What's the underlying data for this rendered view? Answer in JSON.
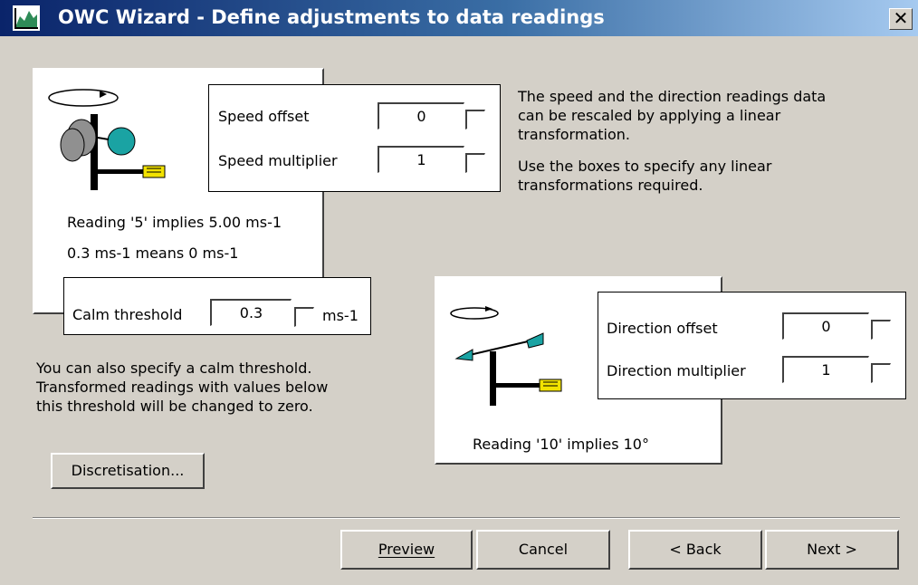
{
  "window": {
    "title": "OWC Wizard - Define adjustments to data readings",
    "close_glyph": "✕"
  },
  "speed": {
    "offset_label": "Speed offset",
    "offset_value": "0",
    "multiplier_label": "Speed multiplier",
    "multiplier_value": "1",
    "reading_text": "Reading '5' implies 5.00 ms-1",
    "threshold_text": "0.3 ms-1 means 0 ms-1"
  },
  "calm": {
    "label": "Calm threshold",
    "value": "0.3",
    "unit": "ms-1",
    "help_lines": [
      "You can also specify a calm threshold.",
      "Transformed readings with values below",
      "this threshold will be changed to zero."
    ]
  },
  "info": {
    "lines1": [
      "The speed and the direction readings data",
      "can be rescaled by applying a linear",
      "transformation."
    ],
    "lines2": [
      "Use the boxes to specify any linear",
      "transformations required."
    ]
  },
  "direction": {
    "offset_label": "Direction offset",
    "offset_value": "0",
    "multiplier_label": "Direction multiplier",
    "multiplier_value": "1",
    "reading_text": "Reading '10' implies 10°"
  },
  "buttons": {
    "discretisation": "Discretisation...",
    "preview": "Preview",
    "cancel": "Cancel",
    "back": "< Back",
    "next": "Next >"
  },
  "icons": {
    "app": "owc-chart-icon",
    "anemometer": "anemometer-icon",
    "wind_vane": "wind-vane-icon"
  },
  "colors": {
    "titlebar_start": "#0a246a",
    "titlebar_end": "#a6caf0",
    "teal": "#1aa3a3",
    "yellow": "#f2e200"
  }
}
